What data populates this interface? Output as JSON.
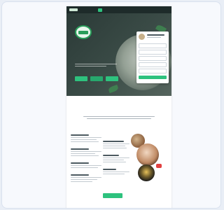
{
  "nav": {
    "links": [],
    "cta_label": "",
    "aux_label": ""
  },
  "hero": {
    "title": "",
    "buttons": []
  },
  "section": {
    "title": ""
  },
  "colors": {
    "brand_green": "#2ec27e",
    "dark": "#1e2b2a",
    "accent_red": "#e14141"
  }
}
